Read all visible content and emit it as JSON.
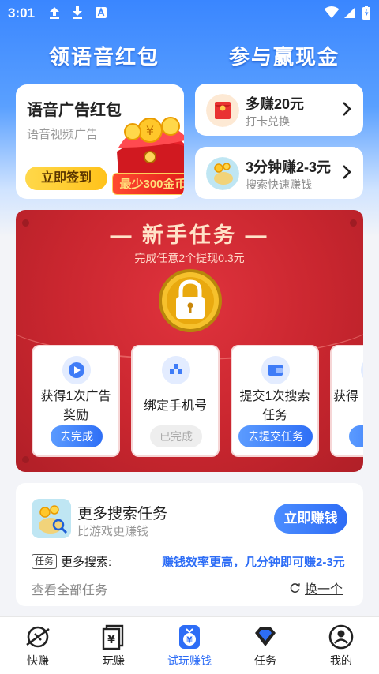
{
  "status_bar": {
    "time": "3:01",
    "icons": [
      "upload-arrow-icon",
      "download-arrow-icon",
      "a-box-icon",
      "wifi-icon",
      "signal-icon",
      "battery-charging-icon"
    ]
  },
  "header": {
    "left_title": "领语音红包",
    "right_title": "参与赢现金"
  },
  "voice_card": {
    "title": "语音广告红包",
    "subtitle": "语音视频广告",
    "checkin_label": "立即签到",
    "coin_tag": "最少300金币"
  },
  "promo_cards": [
    {
      "title": "多赚20元",
      "subtitle": "打卡兑换",
      "icon": "red-envelope-icon"
    },
    {
      "title": "3分钟赚2-3元",
      "subtitle": "搜索快速赚钱",
      "icon": "money-bag-icon"
    }
  ],
  "novice": {
    "title": "— 新手任务 —",
    "subtitle": "完成任意2个提现0.3元",
    "tasks": [
      {
        "name": "获得1次广告奖励",
        "button": "去完成",
        "state": "active",
        "icon": "play-icon"
      },
      {
        "name": "绑定手机号",
        "button": "已完成",
        "state": "done",
        "icon": "blocks-icon"
      },
      {
        "name": "提交1次搜索任务",
        "button": "去提交任务",
        "state": "active",
        "icon": "wallet-icon"
      },
      {
        "name": "获得",
        "button": "去",
        "state": "active",
        "icon": "gift-icon"
      }
    ]
  },
  "search_tasks": {
    "title": "更多搜索任务",
    "subtitle": "比游戏更赚钱",
    "earn_button": "立即赚钱",
    "tag": "任务",
    "more_label": "更多搜索:",
    "highlight": "赚钱效率更高，几分钟即可赚2-3元",
    "view_all": "查看全部任务",
    "swap": "换一个"
  },
  "bottom_nav": {
    "active_index": 2,
    "items": [
      {
        "label": "快赚",
        "icon": "planet-icon"
      },
      {
        "label": "玩赚",
        "icon": "yuan-cards-icon"
      },
      {
        "label": "试玩赚钱",
        "icon": "yuan-bag-icon"
      },
      {
        "label": "任务",
        "icon": "diamond-icon"
      },
      {
        "label": "我的",
        "icon": "user-icon"
      }
    ]
  },
  "colors": {
    "primary_blue": "#2d6df6",
    "red_panel": "#c9262f",
    "gold": "#ffc21a"
  }
}
